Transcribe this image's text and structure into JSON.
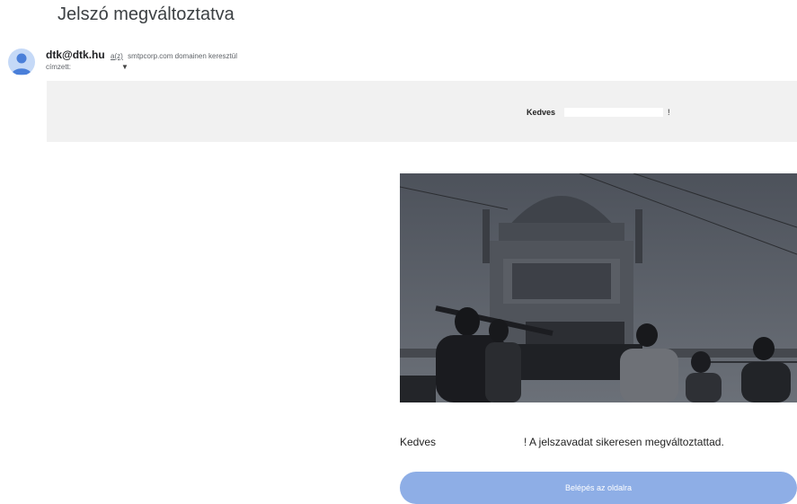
{
  "email": {
    "subject": "Jelszó megváltoztatva",
    "sender": {
      "email": "dtk@dtk.hu",
      "via_link": "a(z)",
      "via_text": "smtpcorp.com domainen keresztül"
    },
    "recipient_label": "címzett:",
    "recipient_caret_icon": "caret-down-icon"
  },
  "banner": {
    "greeting": "Kedves",
    "exclamation": "!"
  },
  "hero_image": {
    "icon": "photo-tank-bridge",
    "colors": {
      "sky": "#5f646c",
      "ground": "#3e4148"
    }
  },
  "body": {
    "greeting": "Kedves",
    "message": "! A jelszavadat sikeresen megváltoztattad."
  },
  "cta": {
    "label": "Belépés az oldalra",
    "color": "#8eaee6"
  }
}
